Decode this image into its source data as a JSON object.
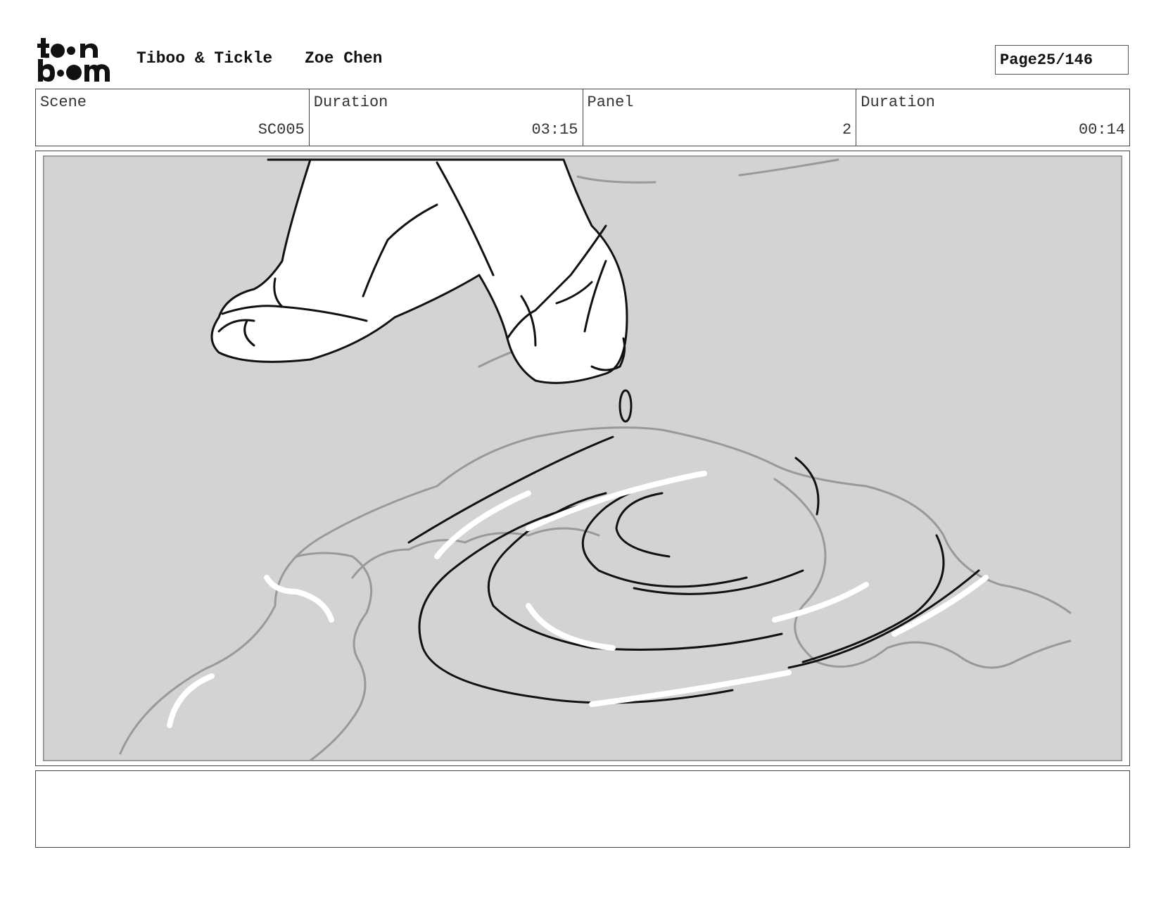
{
  "header": {
    "logo_text": "toon boom",
    "project_title": "Tiboo & Tickle",
    "author": "Zoe Chen",
    "page_label": "Page",
    "page_number": "25/146"
  },
  "info": {
    "scene_label": "Scene",
    "scene_value": "SC005",
    "scene_duration_label": "Duration",
    "scene_duration_value": "03:15",
    "panel_label": "Panel",
    "panel_value": "2",
    "panel_duration_label": "Duration",
    "panel_duration_value": "00:14"
  },
  "panel": {
    "background_color": "#d3d3d3",
    "content": "sketch-drawing"
  },
  "notes": {
    "text": ""
  }
}
